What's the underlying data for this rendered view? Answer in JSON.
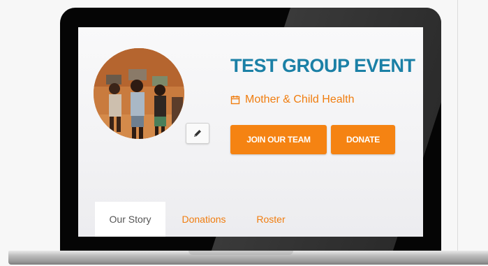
{
  "event": {
    "title": "TEST GROUP EVENT",
    "cause": "Mother & Child Health"
  },
  "actions": {
    "join_label": "JOIN OUR TEAM",
    "donate_label": "DONATE"
  },
  "tabs": [
    {
      "label": "Our Story",
      "active": true
    },
    {
      "label": "Donations",
      "active": false
    },
    {
      "label": "Roster",
      "active": false
    }
  ],
  "icons": {
    "cause": "calendar-icon",
    "edit": "pencil-icon"
  },
  "colors": {
    "accent": "#f58312",
    "title": "#1b80a6",
    "link": "#f07d0f"
  }
}
